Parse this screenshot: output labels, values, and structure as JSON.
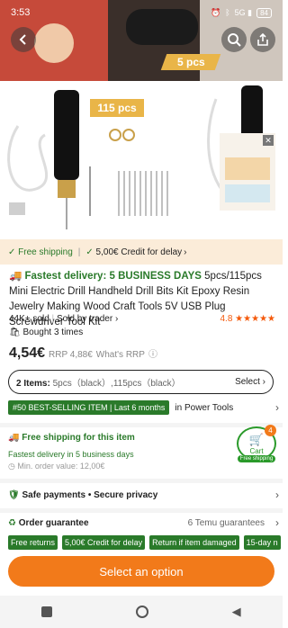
{
  "status": {
    "time": "3:53",
    "battery": "84"
  },
  "hero": {
    "banner_top": "5 pcs",
    "banner_mid": "115 pcs",
    "product_label": "Product image"
  },
  "shipping": {
    "free_label": "Free shipping",
    "credit_label": "5,00€ Credit for delay"
  },
  "product": {
    "fast_label": "Fastest delivery: 5 BUSINESS DAYS",
    "title": "5pcs/115pcs Mini Electric Drill Handheld Drill Bits Kit Epoxy Resin Jewelry Making Wood Craft Tools 5V USB Plug Screwdriver Tool Kit",
    "sold": "44K+ sold",
    "seller": "Sold by trader",
    "rating": "4.8",
    "stars": "★★★★★",
    "bought": "Bought 3 times",
    "price": "4,54€",
    "rrp": "RRP 4,88€",
    "whats_rrp": "What's RRP"
  },
  "variants": {
    "label": "2 Items:",
    "options": "5pcs（black）,115pcs（black）",
    "select": "Select"
  },
  "bestseller": {
    "tag": "#50 BEST-SELLING ITEM | Last 6 months",
    "category": "in Power Tools"
  },
  "delivery": {
    "free": "Free shipping for this item",
    "fastest": "Fastest delivery in 5 business days",
    "min_order": "Min. order value: 12,00€"
  },
  "cart": {
    "count": "4",
    "label": "Cart",
    "free": "Free shipping"
  },
  "safe": {
    "label": "Safe payments",
    "privacy": "Secure privacy"
  },
  "guarantee": {
    "label": "Order guarantee",
    "count": "6 Temu guarantees"
  },
  "pills": [
    "Free returns",
    "5,00€ Credit for delay",
    "Return if item damaged",
    "15-day n"
  ],
  "cta": {
    "label": "Select an option"
  },
  "colors": {
    "orange": "#f27a1a",
    "green": "#2a7a2a",
    "gold": "#e9b548"
  }
}
